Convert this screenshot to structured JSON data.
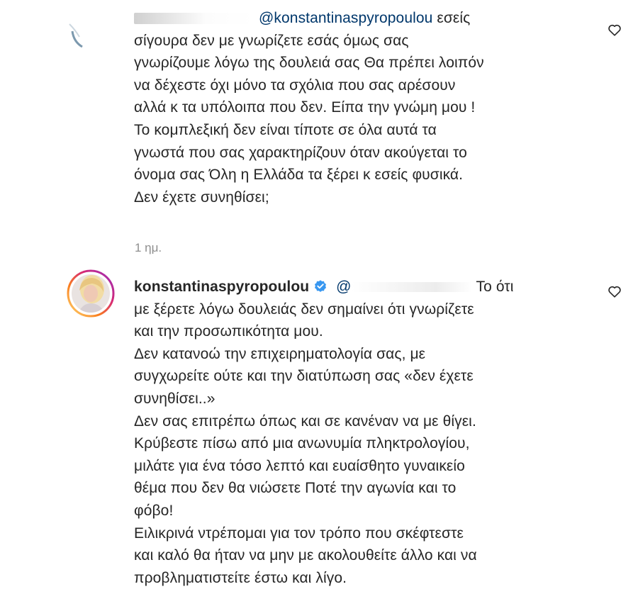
{
  "comments": [
    {
      "mention": "@konstantinaspyropoulou",
      "body_first": " εσείς",
      "lines": [
        "σίγουρα δεν με γνωρίζετε εσάς όμως σας",
        "γνωρίζουμε λόγω της δουλειά σας Θα πρέπει λοιπόν",
        "να δέχεστε όχι μόνο τα σχόλια που σας αρέσουν",
        "αλλά κ τα υπόλοιπα που δεν. Είπα την γνώμη μου !",
        "Το κομπλεξική δεν είναι τίποτε σε όλα αυτά τα",
        "γνωστά που σας χαρακτηρίζουν όταν ακούγεται το",
        "όνομα σας Όλη η Ελλάδα τα ξέρει κ εσείς φυσικά.",
        "Δεν έχετε συνηθίσει;"
      ],
      "time": "1 ημ.",
      "icons": {
        "like": "heart-outline-icon"
      }
    },
    {
      "username": "konstantinaspyropoulou",
      "mention_prefix": "@",
      "first_line_tail": "Το ότι",
      "lines": [
        "με ξέρετε λόγω δουλειάς δεν σημαίνει ότι γνωρίζετε",
        "και την προσωπικότητα μου.",
        "Δεν κατανοώ την επιχειρηματολογία σας, με",
        "συγχωρείτε ούτε και την διατύπωση σας «δεν έχετε",
        "συνηθίσει..»",
        "Δεν σας επιτρέπω όπως και σε κανέναν να με θίγει.",
        "Κρύβεστε πίσω από μια ανωνυμία πληκτρολογίου,",
        "μιλάτε για ένα τόσο λεπτό και ευαίσθητο γυναικείο",
        "θέμα που δεν θα νιώσετε Ποτέ την αγωνία και το",
        "φόβο!",
        "Ειλικρινά ντρέπομαι για τον τρόπο που σκέφτεστε",
        "και καλό θα ήταν να μην με ακολουθείτε άλλο και να",
        "προβληματιστείτε έστω και λίγο."
      ],
      "icons": {
        "verified": "verified-badge-icon",
        "like": "heart-outline-icon"
      }
    }
  ],
  "colors": {
    "text": "#262626",
    "mention": "#00376b",
    "muted": "#8e8e8e",
    "verified": "#3897f0"
  }
}
